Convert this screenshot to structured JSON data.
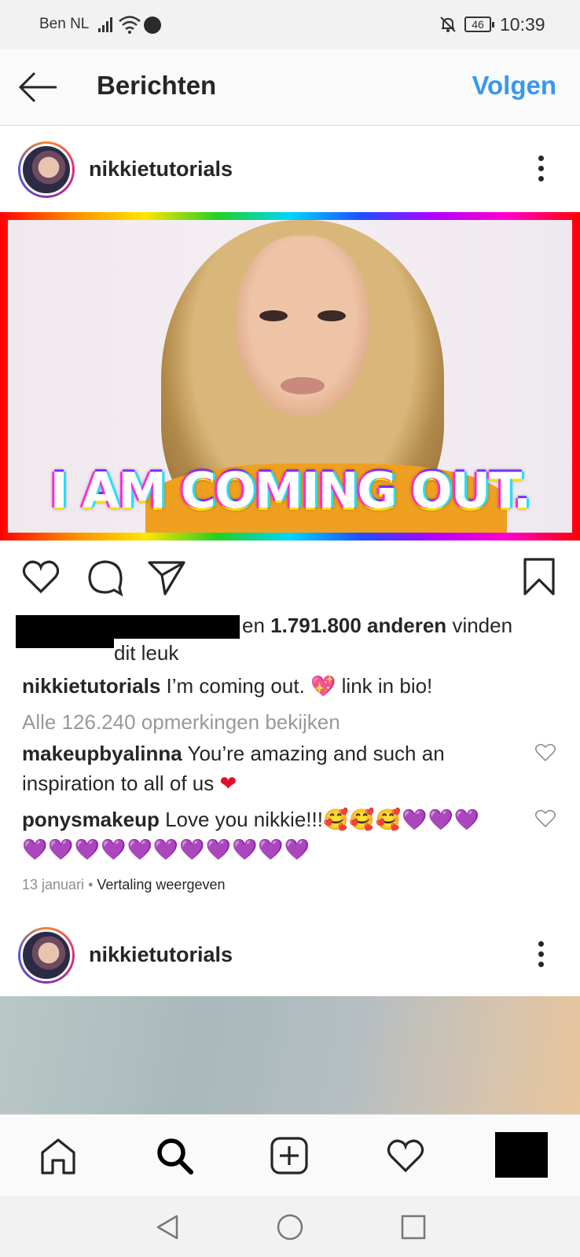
{
  "status_bar": {
    "carrier": "Ben NL",
    "battery": "46",
    "time": "10:39"
  },
  "header": {
    "title": "Berichten",
    "follow_label": "Volgen"
  },
  "post": {
    "username": "nikkietutorials",
    "image_text": "I AM COMING OUT.",
    "likes_prefix": "en",
    "likes_count": "1.791.800 anderen",
    "likes_suffix": "vinden",
    "likes_line2": "dit leuk",
    "caption_user": "nikkietutorials",
    "caption_text": "I’m coming out.",
    "caption_emoji": "💖",
    "caption_end": "link in bio!",
    "view_comments": "Alle 126.240 opmerkingen bekijken",
    "comments": [
      {
        "user": "makeupbyalinna",
        "text": "You’re amazing and such an",
        "text2": "inspiration to all of us",
        "emoji": "❤"
      },
      {
        "user": "ponysmakeup",
        "text": "Love you nikkie!!!",
        "emoji": "🥰🥰🥰💜💜💜",
        "emoji2": "💜💜💜💜💜💜💜💜💜💜💜"
      }
    ],
    "date": "13 januari",
    "translate": "Vertaling weergeven"
  },
  "second_post": {
    "username": "nikkietutorials"
  },
  "icons": {
    "back": "arrow-left-icon",
    "more": "more-vertical-icon",
    "like": "heart-icon",
    "comment": "comment-icon",
    "share": "paper-plane-icon",
    "save": "bookmark-icon",
    "home": "home-icon",
    "search": "search-icon",
    "add": "plus-square-icon",
    "activity": "heart-icon",
    "profile": "profile-icon"
  },
  "colors": {
    "accent": "#3897f0",
    "text": "#262626",
    "muted": "#999999"
  }
}
